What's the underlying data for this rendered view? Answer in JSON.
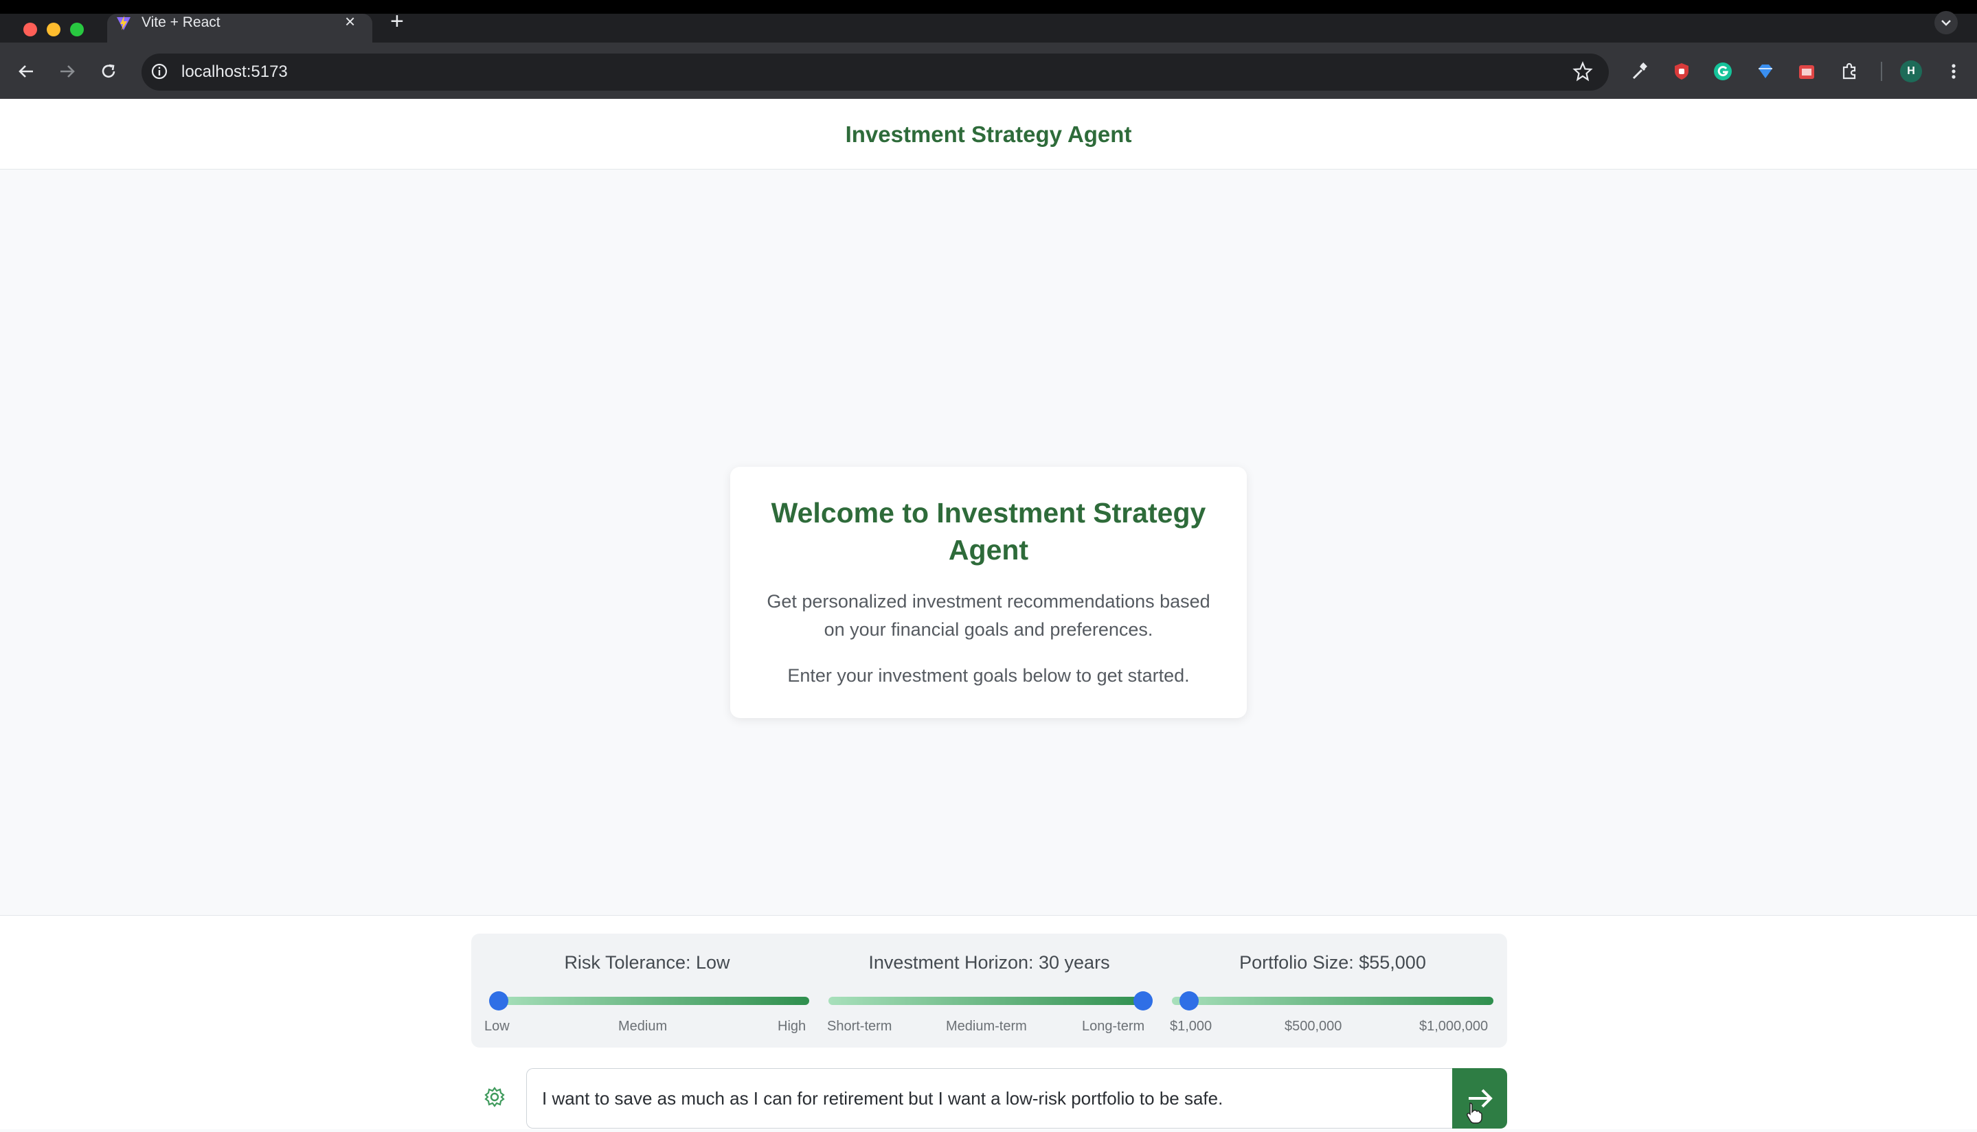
{
  "browser": {
    "tab_title": "Vite + React",
    "tab_close": "×",
    "new_tab": "+",
    "url": "localhost:5173",
    "profile_initial": "H"
  },
  "app": {
    "title": "Investment Strategy Agent"
  },
  "welcome": {
    "title_line1": "Welcome to Investment Strategy",
    "title_line2": "Agent",
    "desc_line1": "Get personalized investment recommendations based",
    "desc_line2": "on your financial goals and preferences.",
    "cta": "Enter your investment goals below to get started."
  },
  "preferences": {
    "risk": {
      "label": "Risk Tolerance: Low",
      "ticks": [
        "Low",
        "Medium",
        "High"
      ],
      "value": 0
    },
    "horizon": {
      "label": "Investment Horizon: 30 years",
      "ticks": [
        "Short-term",
        "Medium-term",
        "Long-term"
      ],
      "value": 1
    },
    "portfolio": {
      "label": "Portfolio Size: $55,000",
      "ticks": [
        "$1,000",
        "$500,000",
        "$1,000,000"
      ],
      "value": 0.054
    }
  },
  "chat": {
    "input_value": "I want to save as much as I can for retirement but I want a low-risk portfolio to be safe."
  },
  "colors": {
    "accent_green": "#2e6b3a",
    "send_green": "#2e7d44",
    "thumb_blue": "#2f6fe6"
  },
  "icons": [
    "arrow-left-icon",
    "arrow-right-icon",
    "reload-icon",
    "info-icon",
    "star-icon",
    "gear-icon",
    "send-arrow-icon",
    "close-icon",
    "plus-icon"
  ]
}
